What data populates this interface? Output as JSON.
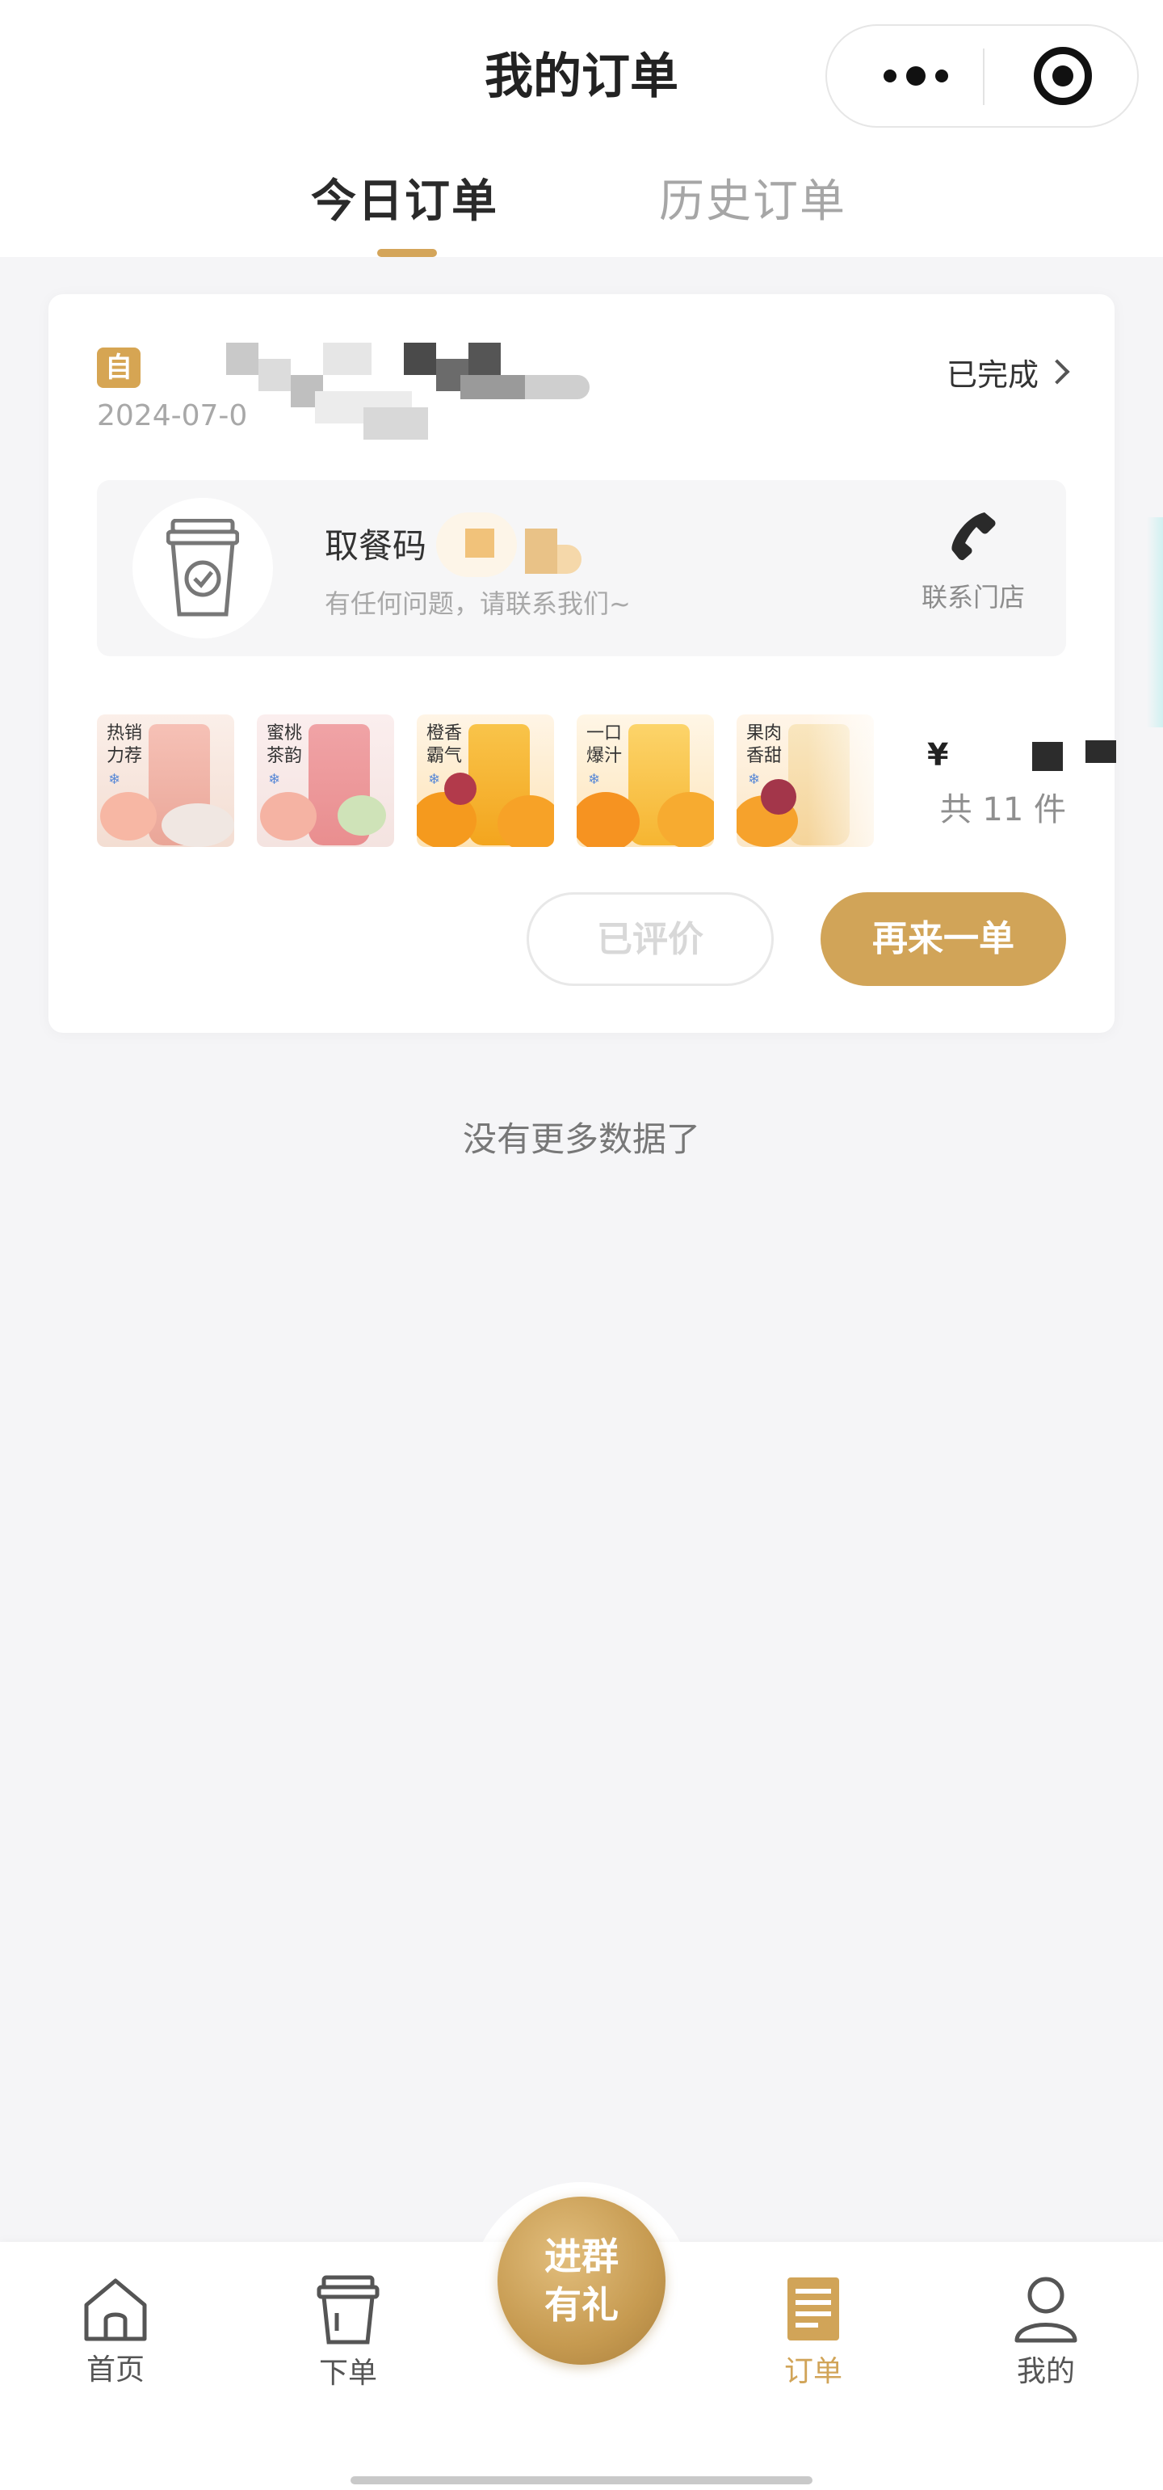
{
  "nav": {
    "title": "我的订单"
  },
  "tabs": {
    "today": "今日订单",
    "history": "历史订单"
  },
  "order": {
    "badge": "自",
    "store_name": "",
    "date": "2024-07-0",
    "status": "已完成",
    "pickup_label": "取餐码",
    "pickup_hint": "有任何问题，请联系我们~",
    "contact_label": "联系门店",
    "price_symbol": "¥",
    "count_text": "共 11 件",
    "products": [
      {
        "tag": "热销力荐",
        "ice": "❄"
      },
      {
        "tag": "蜜桃茶韵",
        "ice": "❄"
      },
      {
        "tag": "橙香霸气",
        "ice": "❄"
      },
      {
        "tag": "一口爆汁",
        "ice": "❄"
      },
      {
        "tag": "果肉香甜",
        "ice": "❄"
      }
    ],
    "review_button": "已评价",
    "reorder_button": "再来一单"
  },
  "footer_text": "没有更多数据了",
  "tabbar": {
    "home": "首页",
    "menu": "下单",
    "center_line1": "进群",
    "center_line2": "有礼",
    "orders": "订单",
    "me": "我的"
  },
  "colors": {
    "accent": "#d1a458",
    "background": "#f5f5f7"
  },
  "icons": {
    "pickup": "coffee-cup-icon",
    "contact": "phone-icon",
    "home": "home-icon",
    "menu": "cup-icon",
    "orders": "orders-icon",
    "me": "user-icon"
  }
}
